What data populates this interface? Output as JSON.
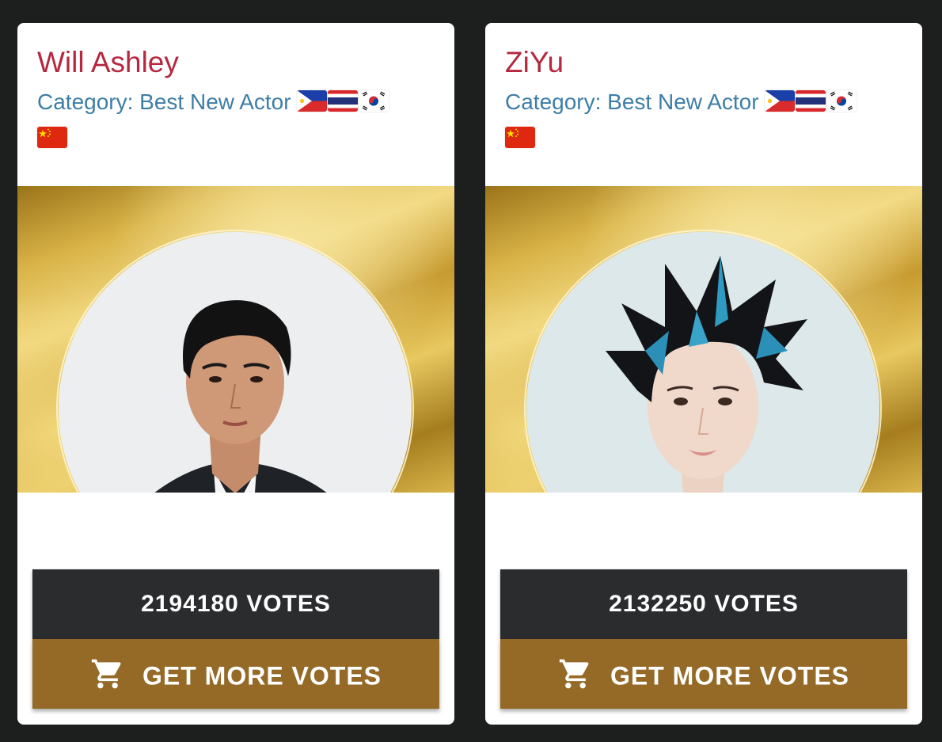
{
  "colors": {
    "page_background": "#1d1f1f",
    "name": "#b5283f",
    "category": "#3d7ea6",
    "votes_box": "#2b2c2e",
    "more_votes_button": "#956a27"
  },
  "nominees": [
    {
      "name": "Will Ashley",
      "category": "Category: Best New Actor",
      "flags_line1": [
        "philippines-flag",
        "thailand-flag",
        "south-korea-flag"
      ],
      "flags_line2": [
        "china-flag"
      ],
      "votes": "2194180 VOTES",
      "button_icon": "cart-icon",
      "button_label": "GET MORE VOTES"
    },
    {
      "name": "ZiYu",
      "category": "Category: Best New Actor",
      "flags_line1": [
        "philippines-flag",
        "thailand-flag",
        "south-korea-flag"
      ],
      "flags_line2": [
        "china-flag"
      ],
      "votes": "2132250 VOTES",
      "button_icon": "cart-icon",
      "button_label": "GET MORE VOTES"
    }
  ]
}
